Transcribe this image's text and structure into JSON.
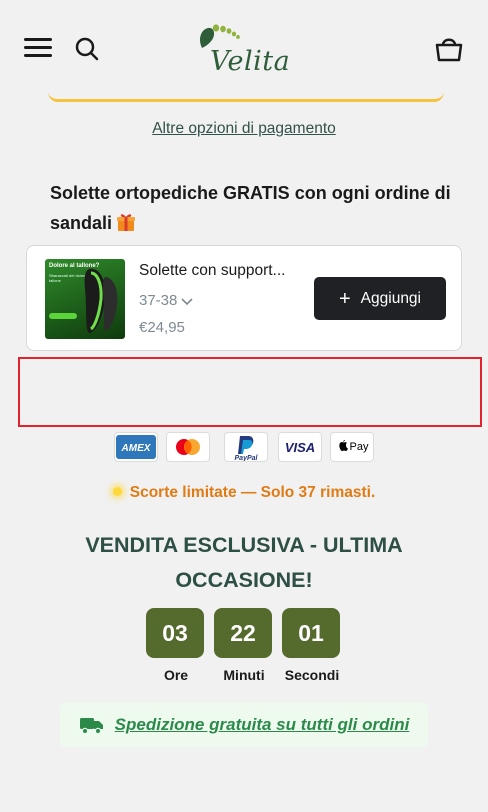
{
  "header": {
    "logo_text": "Velita",
    "brand_color": "#2f5d3a",
    "icons": [
      "menu-icon",
      "search-icon",
      "cart-icon"
    ]
  },
  "payment": {
    "other_options_label": "Altre opzioni di pagamento",
    "methods": [
      "AMEX",
      "Mastercard",
      "PayPal",
      "VISA",
      "Apple Pay"
    ]
  },
  "upsell": {
    "title": "Solette ortopediche GRATIS con ogni ordine di sandali",
    "product": {
      "name": "Solette con support...",
      "variant": "37-38",
      "price": "€24,95",
      "thumb_heading": "Dolore al tallone?",
      "thumb_caption": "Sbarazzati del dolore al tallone"
    },
    "add_button_label": "Aggiungi"
  },
  "stock": {
    "text": "Scorte limitate — Solo 37 rimasti.",
    "color": "#e07b14"
  },
  "sale": {
    "title": "VENDITA ESCLUSIVA - ULTIMA OCCASIONE!"
  },
  "countdown": [
    {
      "value": "03",
      "label": "Ore"
    },
    {
      "value": "22",
      "label": "Minuti"
    },
    {
      "value": "01",
      "label": "Secondi"
    }
  ],
  "shipping": {
    "text": "Spedizione gratuita su tutti gli ordini"
  }
}
